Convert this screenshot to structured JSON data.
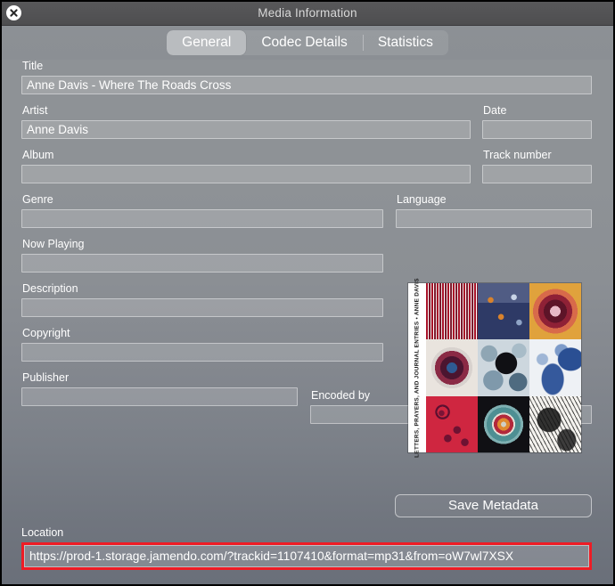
{
  "window": {
    "title": "Media Information",
    "close_icon": "close-circle-icon"
  },
  "tabs": [
    {
      "label": "General",
      "active": true
    },
    {
      "label": "Codec Details",
      "active": false
    },
    {
      "label": "Statistics",
      "active": false
    }
  ],
  "fields": {
    "title": {
      "label": "Title",
      "value": "Anne Davis - Where The Roads Cross",
      "placeholder": ""
    },
    "artist": {
      "label": "Artist",
      "value": "Anne Davis",
      "placeholder": ""
    },
    "date": {
      "label": "Date",
      "value": "",
      "placeholder": ""
    },
    "album": {
      "label": "Album",
      "value": "",
      "placeholder": ""
    },
    "track_number": {
      "label": "Track number",
      "value": "",
      "placeholder": ""
    },
    "genre": {
      "label": "Genre",
      "value": "",
      "placeholder": ""
    },
    "language": {
      "label": "Language",
      "value": "",
      "placeholder": ""
    },
    "now_playing": {
      "label": "Now Playing",
      "value": "",
      "placeholder": ""
    },
    "description": {
      "label": "Description",
      "value": "",
      "placeholder": ""
    },
    "copyright": {
      "label": "Copyright",
      "value": "",
      "placeholder": ""
    },
    "publisher": {
      "label": "Publisher",
      "value": "",
      "placeholder": ""
    },
    "encoded_by": {
      "label": "Encoded by",
      "value": "",
      "placeholder": ""
    },
    "location": {
      "label": "Location",
      "value": "https://prod-1.storage.jamendo.com/?trackid=1107410&format=mp31&from=oW7wl7XSX",
      "placeholder": ""
    }
  },
  "album_art": {
    "name": "album-cover-art",
    "spine_text": "LETTERS, PRAYERS, AND JOURNAL ENTRIES • ANNE DAVIS"
  },
  "buttons": {
    "save_metadata": "Save Metadata"
  },
  "colors": {
    "highlight_box": "#ee1c25",
    "titlebar": "#4e4e50",
    "active_tab": "#b9bcbf",
    "text": "#ffffff"
  }
}
